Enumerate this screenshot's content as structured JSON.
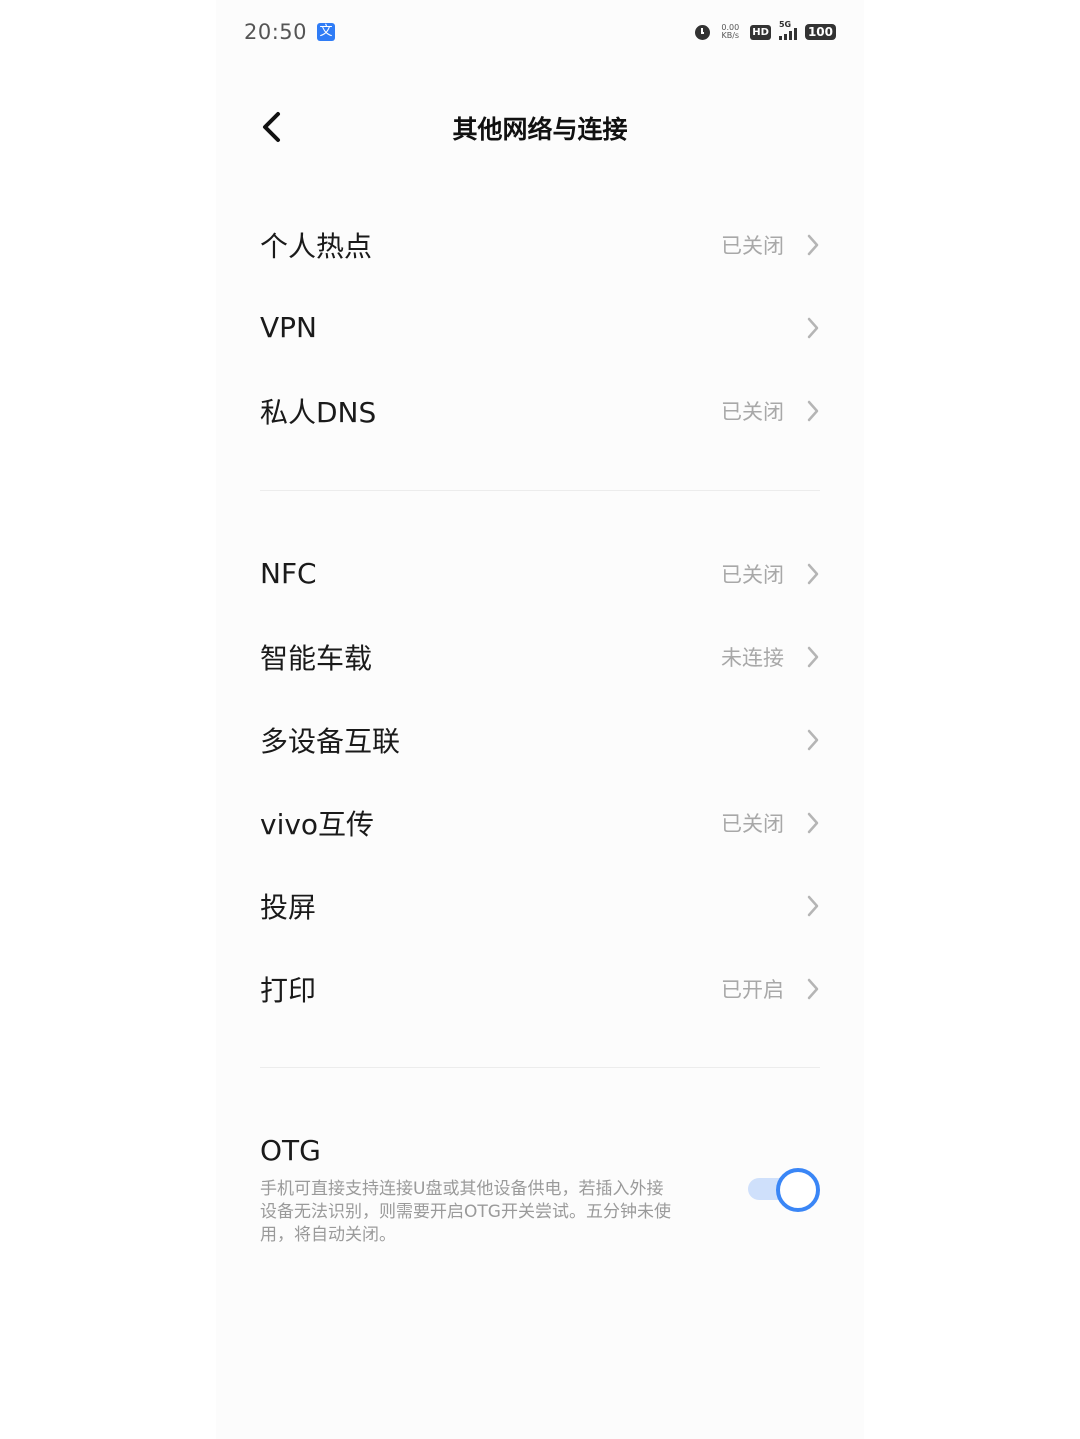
{
  "status_bar": {
    "time": "20:50",
    "ime": "文",
    "netspeed_value": "0.00",
    "netspeed_unit": "KB/s",
    "hd": "HD",
    "network": "5G",
    "battery": "100"
  },
  "header": {
    "title": "其他网络与连接"
  },
  "group1": [
    {
      "label": "个人热点",
      "status": "已关闭"
    },
    {
      "label": "VPN",
      "status": ""
    },
    {
      "label": "私人DNS",
      "status": "已关闭"
    }
  ],
  "group2": [
    {
      "label": "NFC",
      "status": "已关闭"
    },
    {
      "label": "智能车载",
      "status": "未连接"
    },
    {
      "label": "多设备互联",
      "status": ""
    },
    {
      "label": "vivo互传",
      "status": "已关闭"
    },
    {
      "label": "投屏",
      "status": ""
    },
    {
      "label": "打印",
      "status": "已开启"
    }
  ],
  "otg": {
    "title": "OTG",
    "description": "手机可直接支持连接U盘或其他设备供电，若插入外接设备无法识别，则需要开启OTG开关尝试。五分钟未使用，将自动关闭。",
    "enabled": true
  },
  "colors": {
    "accent": "#3a86f6",
    "status_text": "#a8a8a8",
    "divider": "#ececec"
  }
}
